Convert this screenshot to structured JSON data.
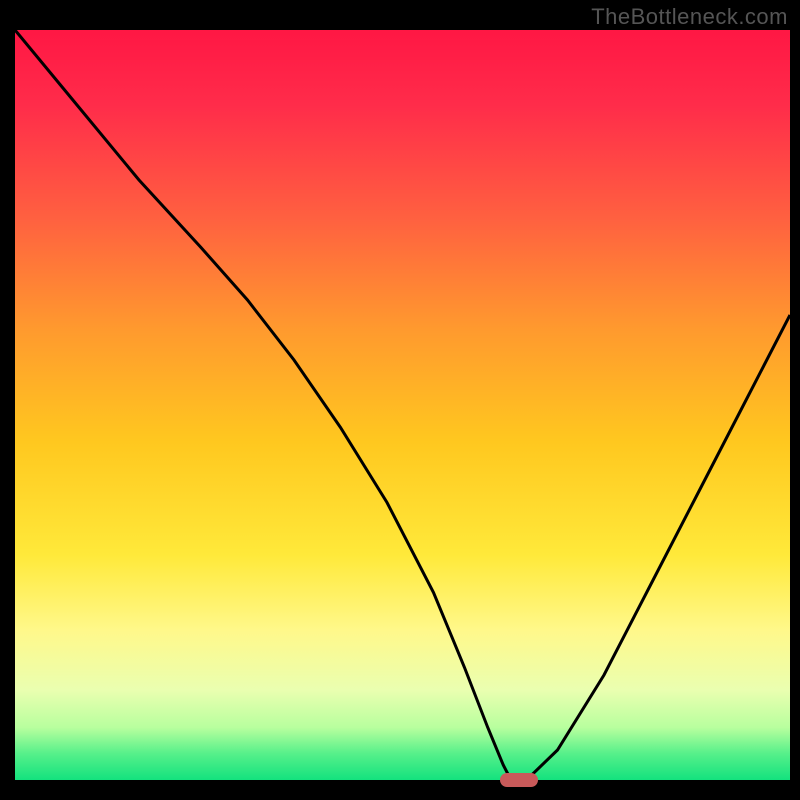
{
  "watermark": "TheBottleneck.com",
  "chart_data": {
    "type": "line",
    "title": "",
    "xlabel": "",
    "ylabel": "",
    "xlim": [
      0,
      100
    ],
    "ylim": [
      0,
      100
    ],
    "grid": false,
    "legend": false,
    "background_gradient_stops": [
      {
        "offset": 0.0,
        "color": "#ff1744"
      },
      {
        "offset": 0.1,
        "color": "#ff2c4a"
      },
      {
        "offset": 0.25,
        "color": "#ff6040"
      },
      {
        "offset": 0.4,
        "color": "#ff9a2e"
      },
      {
        "offset": 0.55,
        "color": "#ffc81f"
      },
      {
        "offset": 0.7,
        "color": "#ffe93a"
      },
      {
        "offset": 0.8,
        "color": "#fff88a"
      },
      {
        "offset": 0.88,
        "color": "#eaffb0"
      },
      {
        "offset": 0.93,
        "color": "#b8ff9e"
      },
      {
        "offset": 0.965,
        "color": "#56f08a"
      },
      {
        "offset": 1.0,
        "color": "#13e27e"
      }
    ],
    "series": [
      {
        "name": "bottleneck-curve",
        "color": "#000000",
        "x": [
          0,
          8,
          16,
          24,
          30,
          36,
          42,
          48,
          54,
          58,
          61,
          63,
          64,
          66,
          70,
          76,
          82,
          88,
          94,
          100
        ],
        "y": [
          100,
          90,
          80,
          71,
          64,
          56,
          47,
          37,
          25,
          15,
          7,
          2,
          0,
          0,
          4,
          14,
          26,
          38,
          50,
          62
        ]
      }
    ],
    "marker": {
      "name": "optimal-point",
      "x": 65,
      "y": 0,
      "color": "#c85a5a"
    }
  }
}
